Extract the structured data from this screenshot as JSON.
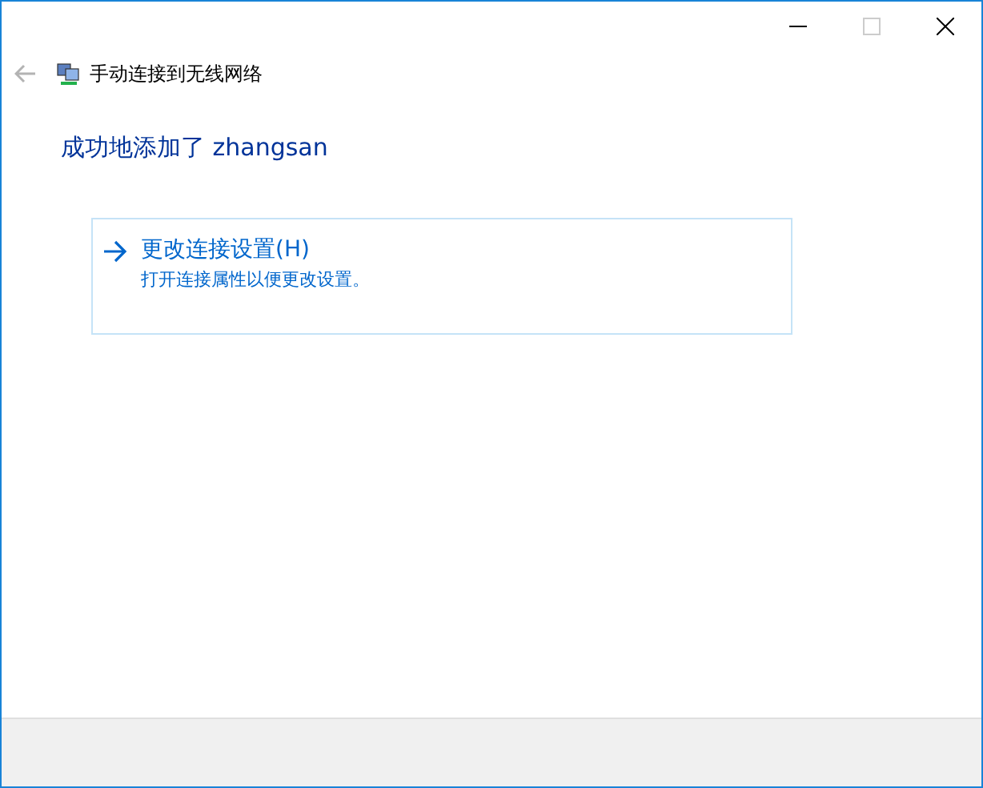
{
  "window": {
    "maximize_disabled": true
  },
  "nav": {
    "back_disabled": true,
    "title": "手动连接到无线网络"
  },
  "heading": "成功地添加了 zhangsan",
  "options": [
    {
      "title": "更改连接设置(H)",
      "description": "打开连接属性以便更改设置。"
    }
  ]
}
